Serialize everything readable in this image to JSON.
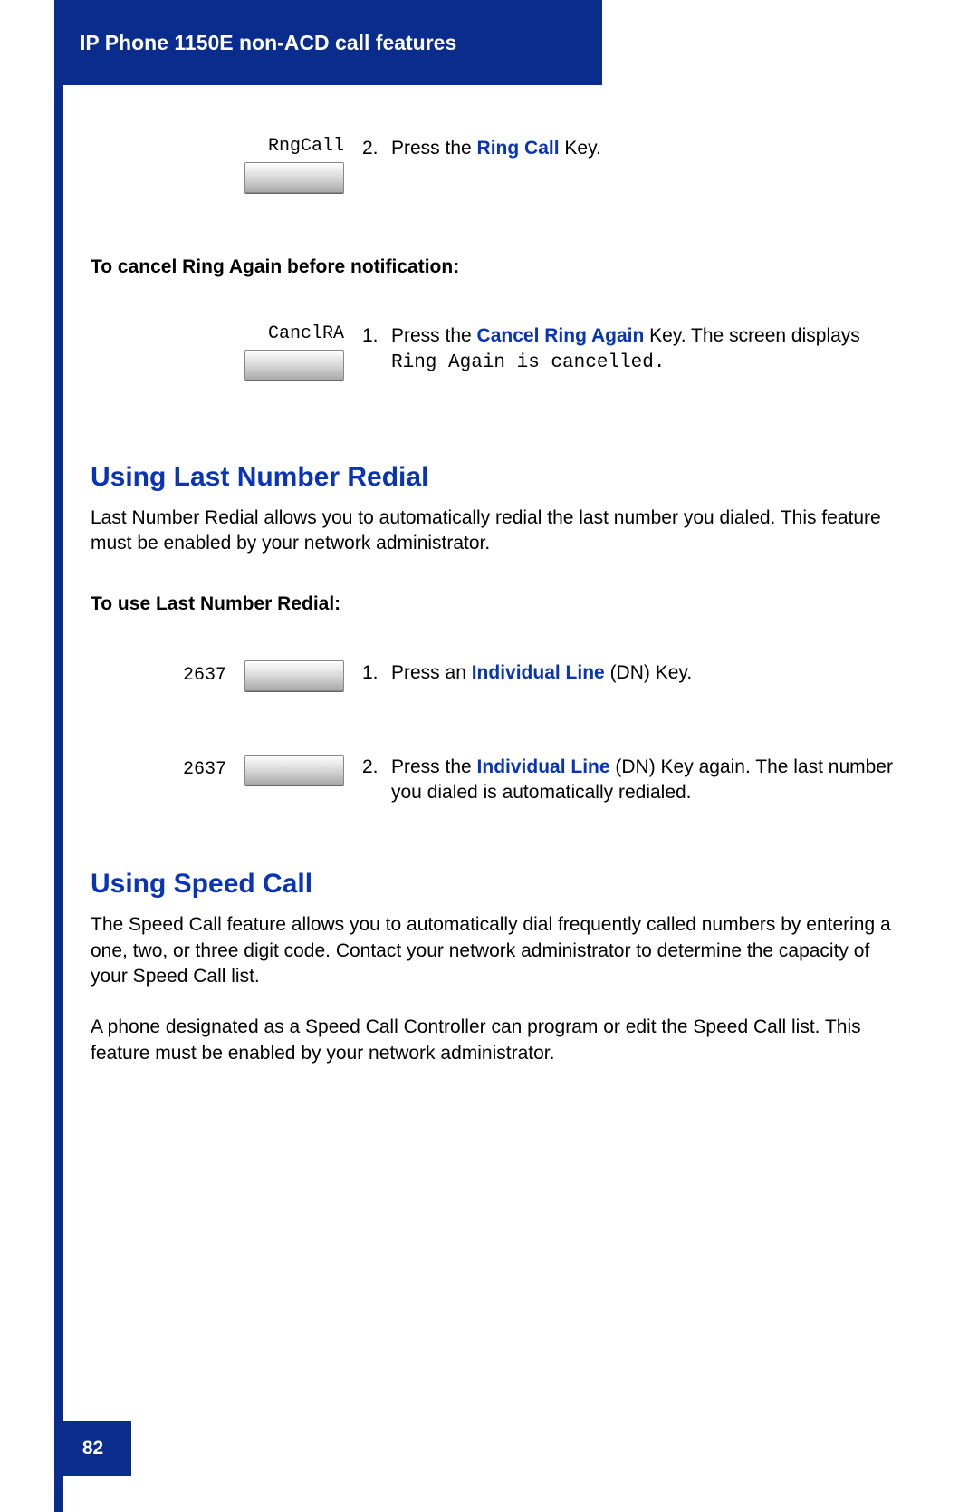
{
  "header": {
    "title": "IP Phone 1150E non-ACD call features"
  },
  "step_ringcall": {
    "keylabel": "RngCall",
    "num": "2.",
    "pre": "Press the ",
    "blue": "Ring Call",
    "post": " Key."
  },
  "sub_cancel": "To cancel Ring Again before notification:",
  "step_cancelra": {
    "keylabel": "CanclRA",
    "num": "1.",
    "pre": "Press the ",
    "blue": "Cancel Ring Again",
    "mid": " Key. The screen displays ",
    "mono": "Ring Again is cancelled."
  },
  "section_redial": {
    "heading": "Using Last Number Redial",
    "body": "Last Number Redial allows you to automatically redial the last number you dialed. This feature must be enabled by your network administrator.",
    "sub": "To use Last Number Redial:"
  },
  "step_dn1": {
    "keylabel": "2637",
    "num": "1.",
    "pre": "Press an ",
    "blue": "Individual Line",
    "post": " (DN) Key."
  },
  "step_dn2": {
    "keylabel": "2637",
    "num": "2.",
    "pre": "Press the ",
    "blue": "Individual Line",
    "post": " (DN) Key again. The last number you dialed is automatically redialed."
  },
  "section_speed": {
    "heading": "Using Speed Call",
    "body1": "The Speed Call feature allows you to automatically dial frequently called numbers by entering a one, two, or three digit code. Contact your network administrator to determine the capacity of your Speed Call list.",
    "body2": "A phone designated as a Speed Call Controller can program or edit the Speed Call list. This feature must be enabled by your network administrator."
  },
  "footer": {
    "page": "82"
  }
}
